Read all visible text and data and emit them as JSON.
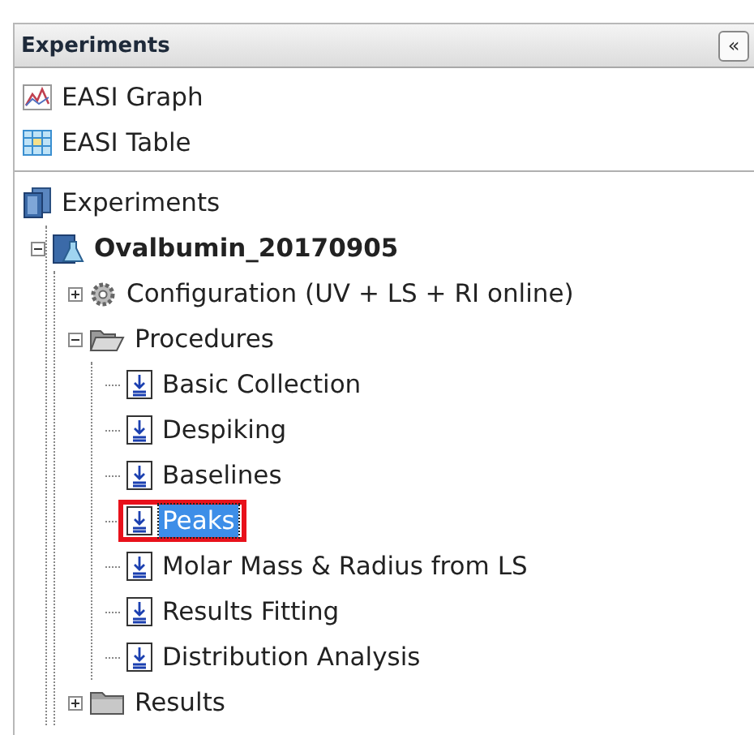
{
  "panel": {
    "title": "Experiments",
    "collapse_button": "«"
  },
  "views": [
    {
      "label": "EASI Graph",
      "kind": "graph"
    },
    {
      "label": "EASI Table",
      "kind": "table"
    }
  ],
  "tree": [
    {
      "label": "Experiments",
      "kind": "library",
      "children": [
        {
          "label": "Ovalbumin_20170905",
          "kind": "experiment",
          "expanded": true,
          "children": [
            {
              "label": "Configuration (UV + LS + RI online)",
              "kind": "gear",
              "expanded": false
            },
            {
              "label": "Procedures",
              "kind": "folder",
              "expanded": true,
              "children": [
                {
                  "label": "Basic Collection",
                  "kind": "procedure",
                  "selected": false,
                  "highlighted": false
                },
                {
                  "label": "Despiking",
                  "kind": "procedure",
                  "selected": false,
                  "highlighted": false
                },
                {
                  "label": "Baselines",
                  "kind": "procedure",
                  "selected": false,
                  "highlighted": false
                },
                {
                  "label": "Peaks",
                  "kind": "procedure",
                  "selected": true,
                  "highlighted": true
                },
                {
                  "label": "Molar Mass & Radius from LS",
                  "kind": "procedure",
                  "selected": false,
                  "highlighted": false
                },
                {
                  "label": "Results Fitting",
                  "kind": "procedure",
                  "selected": false,
                  "highlighted": false
                },
                {
                  "label": "Distribution Analysis",
                  "kind": "procedure",
                  "selected": false,
                  "highlighted": false
                }
              ]
            },
            {
              "label": "Results",
              "kind": "closed-folder",
              "expanded": false
            }
          ]
        }
      ]
    }
  ]
}
